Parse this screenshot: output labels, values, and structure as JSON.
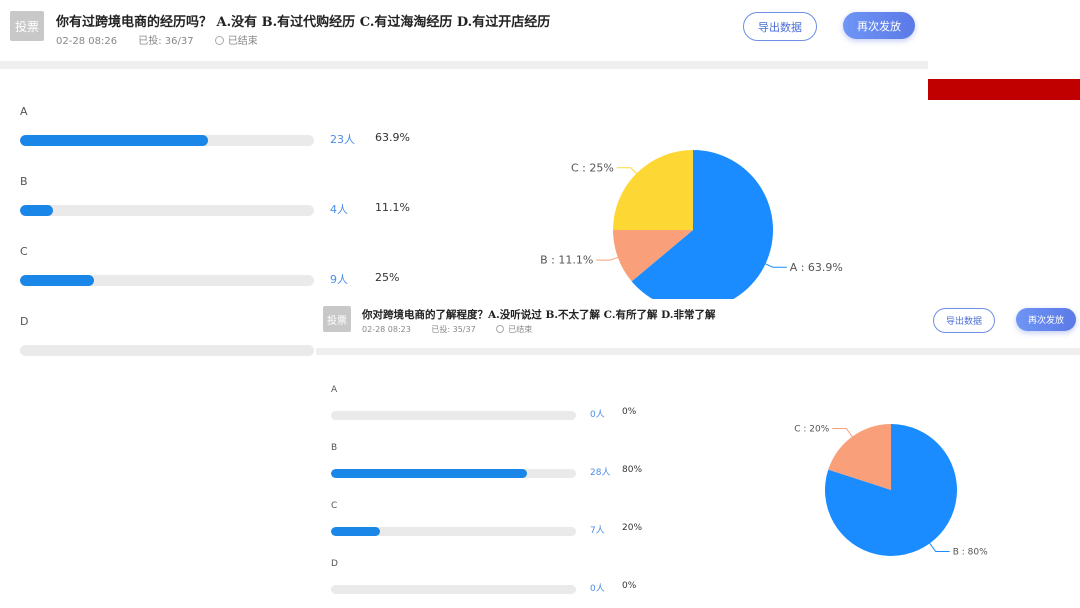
{
  "poll1": {
    "badge": "投票",
    "title": "你有过跨境电商的经历吗？ A.没有  B.有过代购经历  C.有过海淘经历  D.有过开店经历",
    "date": "02-28 08:26",
    "voted": "已投: 36/37",
    "status": "已结束",
    "export_label": "导出数据",
    "resend_label": "再次发放",
    "options": [
      {
        "label": "A",
        "count": "23人",
        "pct": "63.9%",
        "value": 0.639
      },
      {
        "label": "B",
        "count": "4人",
        "pct": "11.1%",
        "value": 0.111
      },
      {
        "label": "C",
        "count": "9人",
        "pct": "25%",
        "value": 0.25
      },
      {
        "label": "D",
        "count": "",
        "pct": "",
        "value": 0
      }
    ],
    "pie": {
      "slices": [
        {
          "name": "A",
          "label": "A : 63.9%",
          "value": 63.9,
          "color": "#1a8cff"
        },
        {
          "name": "B",
          "label": "B : 11.1%",
          "value": 11.1,
          "color": "#f9a07a"
        },
        {
          "name": "C",
          "label": "C : 25%",
          "value": 25,
          "color": "#fdd835"
        }
      ]
    }
  },
  "poll2": {
    "badge": "投票",
    "title": "你对跨境电商的了解程度？A.没听说过  B.不太了解  C.有所了解  D.非常了解",
    "date": "02-28 08:23",
    "voted": "已投: 35/37",
    "status": "已结束",
    "export_label": "导出数据",
    "resend_label": "再次发放",
    "options": [
      {
        "label": "A",
        "count": "0人",
        "pct": "0%",
        "value": 0
      },
      {
        "label": "B",
        "count": "28人",
        "pct": "80%",
        "value": 0.8
      },
      {
        "label": "C",
        "count": "7人",
        "pct": "20%",
        "value": 0.2
      },
      {
        "label": "D",
        "count": "0人",
        "pct": "0%",
        "value": 0
      }
    ],
    "pie": {
      "slices": [
        {
          "name": "B",
          "label": "B : 80%",
          "value": 80,
          "color": "#1a8cff"
        },
        {
          "name": "C",
          "label": "C : 20%",
          "value": 20,
          "color": "#f9a07a"
        }
      ]
    }
  },
  "colors": {
    "accent": "#1a86e8",
    "track": "#eaeaea",
    "count_text": "#4c8de6",
    "red_band": "#c00000"
  }
}
